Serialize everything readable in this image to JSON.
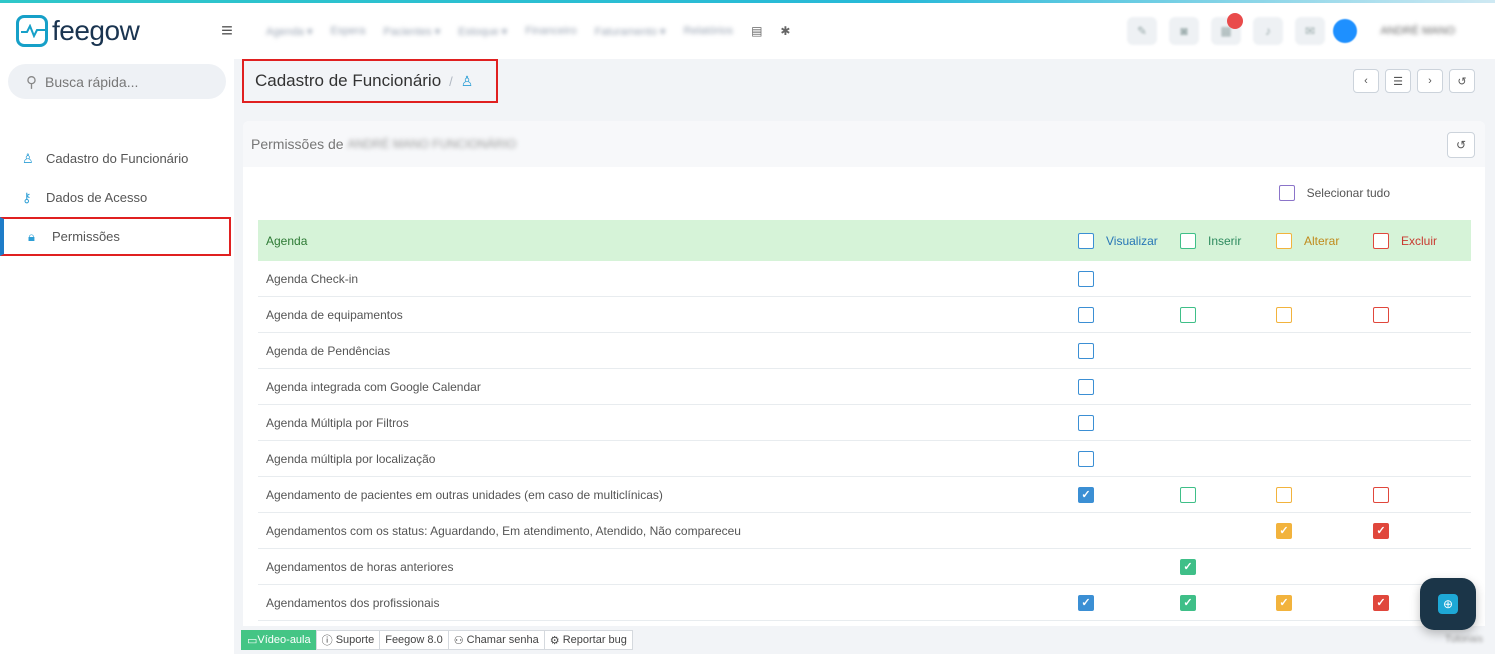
{
  "app": {
    "logo_text": "feegow"
  },
  "topnav": {
    "items": [
      "Agenda ▾",
      "Espera",
      "Pacientes ▾",
      "Estoque ▾",
      "Financeiro",
      "Faturamento ▾",
      "Relatórios"
    ]
  },
  "user": {
    "name": "ANDRÉ MANO"
  },
  "sidebar": {
    "search_placeholder": "Busca rápida...",
    "items": [
      {
        "label": "Cadastro do Funcionário",
        "icon": "user-icon"
      },
      {
        "label": "Dados de Acesso",
        "icon": "key-icon"
      },
      {
        "label": "Permissões",
        "icon": "lock-icon",
        "active": true
      }
    ]
  },
  "breadcrumb": {
    "title": "Cadastro de Funcionário",
    "separator": "/"
  },
  "panel": {
    "title_prefix": "Permissões de",
    "title_name": "ANDRÉ MANO FUNCIONÁRIO",
    "select_all": "Selecionar tudo"
  },
  "table": {
    "group": "Agenda",
    "columns": [
      "Visualizar",
      "Inserir",
      "Alterar",
      "Excluir"
    ],
    "rows": [
      {
        "label": "Agenda Check-in",
        "cells": [
          "empty",
          null,
          null,
          null
        ]
      },
      {
        "label": "Agenda de equipamentos",
        "cells": [
          "empty",
          "empty",
          "empty",
          "empty"
        ]
      },
      {
        "label": "Agenda de Pendências",
        "cells": [
          "empty",
          null,
          null,
          null
        ]
      },
      {
        "label": "Agenda integrada com Google Calendar",
        "cells": [
          "empty",
          null,
          null,
          null
        ]
      },
      {
        "label": "Agenda Múltipla por Filtros",
        "cells": [
          "empty",
          null,
          null,
          null
        ]
      },
      {
        "label": "Agenda múltipla por localização",
        "cells": [
          "empty",
          null,
          null,
          null
        ]
      },
      {
        "label": "Agendamento de pacientes em outras unidades (em caso de multiclínicas)",
        "cells": [
          "checked",
          "empty",
          "empty",
          "empty"
        ]
      },
      {
        "label": "Agendamentos com os status: Aguardando, Em atendimento, Atendido, Não compareceu",
        "cells": [
          null,
          null,
          "checked",
          "checked"
        ]
      },
      {
        "label": "Agendamentos de horas anteriores",
        "cells": [
          null,
          "checked",
          null,
          null
        ]
      },
      {
        "label": "Agendamentos dos profissionais",
        "cells": [
          "checked",
          "checked",
          "checked",
          "checked"
        ]
      }
    ]
  },
  "footer": {
    "items": [
      "Vídeo-aula",
      "Suporte",
      "Feegow 8.0",
      "Chamar senha",
      "Reportar bug"
    ],
    "right_text": "Tutoriais"
  },
  "colors": {
    "accent": "#1e7cc8",
    "header_green": "#d6f3d8",
    "highlight": "#e02020"
  }
}
